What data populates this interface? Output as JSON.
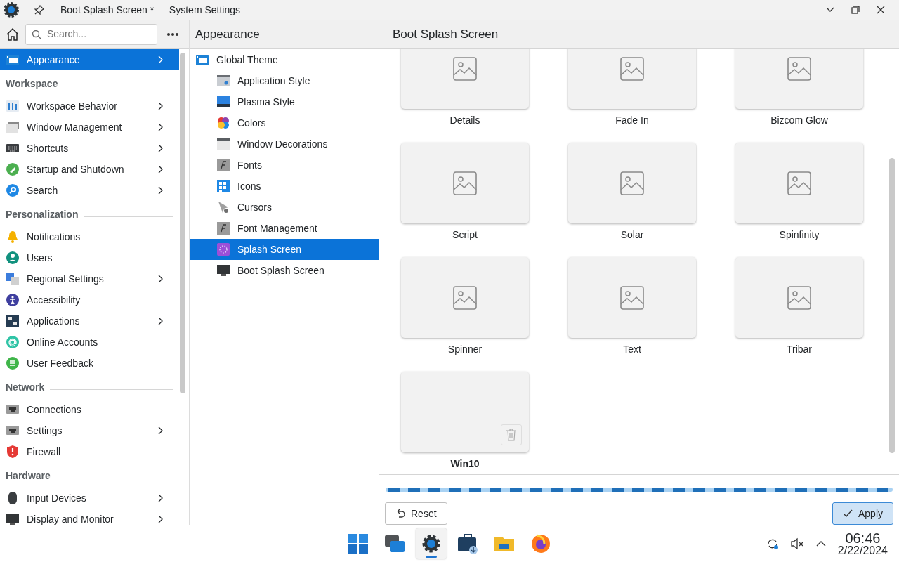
{
  "window": {
    "title": "Boot Splash Screen * — System Settings"
  },
  "sidebar": {
    "search": {
      "placeholder": "Search..."
    },
    "groups": [
      {
        "items": [
          {
            "label": "Appearance",
            "selected": true,
            "submenu": true
          }
        ]
      },
      {
        "heading": "Workspace",
        "items": [
          {
            "label": "Workspace Behavior",
            "selected": false,
            "submenu": true
          },
          {
            "label": "Window Management",
            "selected": false,
            "submenu": true
          },
          {
            "label": "Shortcuts",
            "selected": false,
            "submenu": true
          },
          {
            "label": "Startup and Shutdown",
            "selected": false,
            "submenu": true
          },
          {
            "label": "Search",
            "selected": false,
            "submenu": true
          }
        ]
      },
      {
        "heading": "Personalization",
        "items": [
          {
            "label": "Notifications",
            "selected": false,
            "submenu": false
          },
          {
            "label": "Users",
            "selected": false,
            "submenu": false
          },
          {
            "label": "Regional Settings",
            "selected": false,
            "submenu": true
          },
          {
            "label": "Accessibility",
            "selected": false,
            "submenu": false
          },
          {
            "label": "Applications",
            "selected": false,
            "submenu": true
          },
          {
            "label": "Online Accounts",
            "selected": false,
            "submenu": false
          },
          {
            "label": "User Feedback",
            "selected": false,
            "submenu": false
          }
        ]
      },
      {
        "heading": "Network",
        "items": [
          {
            "label": "Connections",
            "selected": false,
            "submenu": false
          },
          {
            "label": "Settings",
            "selected": false,
            "submenu": true
          },
          {
            "label": "Firewall",
            "selected": false,
            "submenu": false
          }
        ]
      },
      {
        "heading": "Hardware",
        "items": [
          {
            "label": "Input Devices",
            "selected": false,
            "submenu": true
          },
          {
            "label": "Display and Monitor",
            "selected": false,
            "submenu": true
          }
        ]
      }
    ]
  },
  "subpanel": {
    "title": "Appearance",
    "items": [
      {
        "label": "Global Theme",
        "selected": false,
        "children": [
          {
            "label": "Application Style",
            "selected": false
          },
          {
            "label": "Plasma Style",
            "selected": false
          },
          {
            "label": "Colors",
            "selected": false
          },
          {
            "label": "Window Decorations",
            "selected": false
          },
          {
            "label": "Fonts",
            "selected": false
          },
          {
            "label": "Icons",
            "selected": false
          },
          {
            "label": "Cursors",
            "selected": false
          },
          {
            "label": "Font Management",
            "selected": false
          },
          {
            "label": "Splash Screen",
            "selected": true
          },
          {
            "label": "Boot Splash Screen",
            "selected": false
          }
        ]
      }
    ]
  },
  "content": {
    "title": "Boot Splash Screen",
    "themes": [
      {
        "name": "Details",
        "kind": "preview"
      },
      {
        "name": "Fade In",
        "kind": "preview"
      },
      {
        "name": "Bizcom Glow",
        "kind": "preview"
      },
      {
        "name": "Script",
        "kind": "preview"
      },
      {
        "name": "Solar",
        "kind": "preview"
      },
      {
        "name": "Spinfinity",
        "kind": "preview"
      },
      {
        "name": "Spinner",
        "kind": "preview"
      },
      {
        "name": "Text",
        "kind": "preview"
      },
      {
        "name": "Tribar",
        "kind": "preview"
      },
      {
        "name": "Win10",
        "kind": "removable"
      }
    ]
  },
  "buttons": [
    {
      "label": "Reset",
      "kind": "reset"
    },
    {
      "label": "Apply",
      "kind": "apply"
    }
  ],
  "taskbar": {
    "apps": [
      {
        "selected": false
      },
      {
        "selected": false
      },
      {
        "selected": true
      },
      {
        "selected": false
      },
      {
        "selected": false
      },
      {
        "selected": false
      }
    ],
    "clock": {
      "time": "06:46",
      "date": "2/22/2024"
    }
  }
}
